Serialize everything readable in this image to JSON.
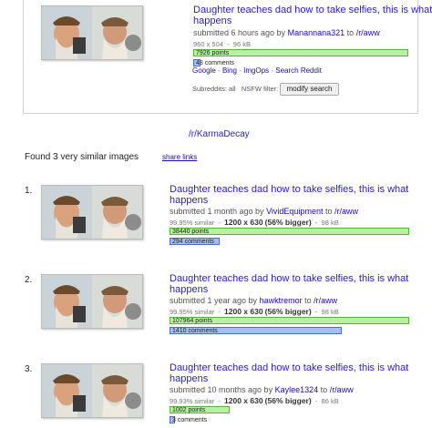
{
  "original": {
    "title": "Daughter teaches dad how to take selfies, this is what happens",
    "submitted": "submitted 6 hours ago by",
    "user": "Manannana321",
    "to": "to",
    "subreddit": "/r/aww",
    "dims": "960 x 504",
    "size": "96 kB",
    "points": "7926 points",
    "points_fraction": 0.22,
    "comments": "48 comments",
    "comments_fraction": 0.03
  },
  "search_links": {
    "google": "Google",
    "bing": "Bing",
    "imgops": "ImgOps",
    "reddit": "Search Reddit",
    "separator": "-"
  },
  "filters": {
    "subreddits_label": "Subreddits:",
    "subreddits_value": "all",
    "nsfw_label": "NSFW filter:",
    "nsfw_value": "on",
    "modify_button": "modify search"
  },
  "karmadecay_link": "/r/KarmaDecay",
  "found_text": "Found 3 very similar images",
  "share_link": "share links",
  "results": [
    {
      "rank": "1.",
      "title": "Daughter teaches dad how to take selfies, this is what happens",
      "submitted": "submitted 1 month ago by",
      "user": "VividEquipment",
      "to": "to",
      "subreddit": "/r/aww",
      "similar": "99.95% similar",
      "dims": "1200 x 630",
      "bigger": "(56% bigger)",
      "size": "98 kB",
      "points": "38440 points",
      "points_fraction": 1.0,
      "comments": "294 comments",
      "comments_fraction": 0.21
    },
    {
      "rank": "2.",
      "title": "Daughter teaches dad how to take selfies, this is what happens",
      "submitted": "submitted 1 year ago by",
      "user": "hawktremor",
      "to": "to",
      "subreddit": "/r/aww",
      "similar": "99.95% similar",
      "dims": "1200 x 630",
      "bigger": "(56% bigger)",
      "size": "98 kB",
      "points": "107964 points",
      "points_fraction": 1.0,
      "comments": "1410 comments",
      "comments_fraction": 0.72
    },
    {
      "rank": "3.",
      "title": "Daughter teaches dad how to take selfies, this is what happens",
      "submitted": "submitted 10 months ago by",
      "user": "Kaylee1324",
      "to": "to",
      "subreddit": "/r/aww",
      "similar": "99.93% similar",
      "dims": "1200 x 630",
      "bigger": "(56% bigger)",
      "size": "86 kB",
      "points": "1002 points",
      "points_fraction": 0.25,
      "comments": "3 comments",
      "comments_fraction": 0.02
    }
  ],
  "colors": {
    "link": "#1a0dab",
    "points_bar": "#b6f0a0",
    "comments_bar": "#a4c0f2"
  }
}
